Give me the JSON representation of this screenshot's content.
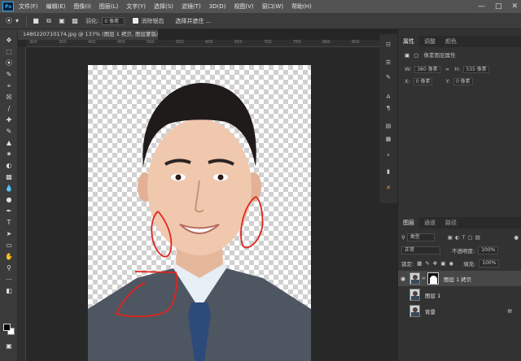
{
  "app": {
    "logo": "Ps",
    "menu": [
      "文件(F)",
      "编辑(E)",
      "图像(I)",
      "图层(L)",
      "文字(Y)",
      "选择(S)",
      "滤镜(T)",
      "3D(D)",
      "视图(V)",
      "窗口(W)",
      "帮助(H)"
    ],
    "window_controls": [
      "minimize-icon",
      "restore-icon",
      "close-icon"
    ]
  },
  "options_bar": {
    "feather_label": "羽化:",
    "feather_value": "0 像素",
    "antialias_label": "消除锯齿",
    "select_mask_button": "选择并遮住 ..."
  },
  "document": {
    "tab_title": "1480220710174.jpg @ 137% (图层 1 拷贝, 图层蒙版/8) *",
    "ruler_ticks": [
      "300",
      "350",
      "400",
      "450",
      "500",
      "550",
      "600",
      "650",
      "700",
      "750",
      "800",
      "850"
    ]
  },
  "properties_panel": {
    "tabs": [
      "属性",
      "调整",
      "颜色"
    ],
    "title": "像素图层属性",
    "w_label": "W:",
    "w_value": "380 像素",
    "h_label": "H:",
    "h_value": "535 像素",
    "x_label": "X:",
    "x_value": "0 像素",
    "y_label": "Y:",
    "y_value": "0 像素"
  },
  "layers_panel": {
    "tabs": [
      "图层",
      "通道",
      "路径"
    ],
    "filter_kind": "类型",
    "blend_mode": "正常",
    "opacity_label": "不透明度:",
    "opacity_value": "100%",
    "lock_label": "锁定:",
    "fill_label": "填充:",
    "fill_value": "100%",
    "layers": [
      {
        "name": "图层 1 拷贝",
        "selected": true,
        "visible": true,
        "has_mask": true
      },
      {
        "name": "图层 1",
        "selected": false,
        "visible": false,
        "has_mask": false
      },
      {
        "name": "背景",
        "selected": false,
        "visible": false,
        "has_mask": false,
        "locked": true
      }
    ]
  }
}
